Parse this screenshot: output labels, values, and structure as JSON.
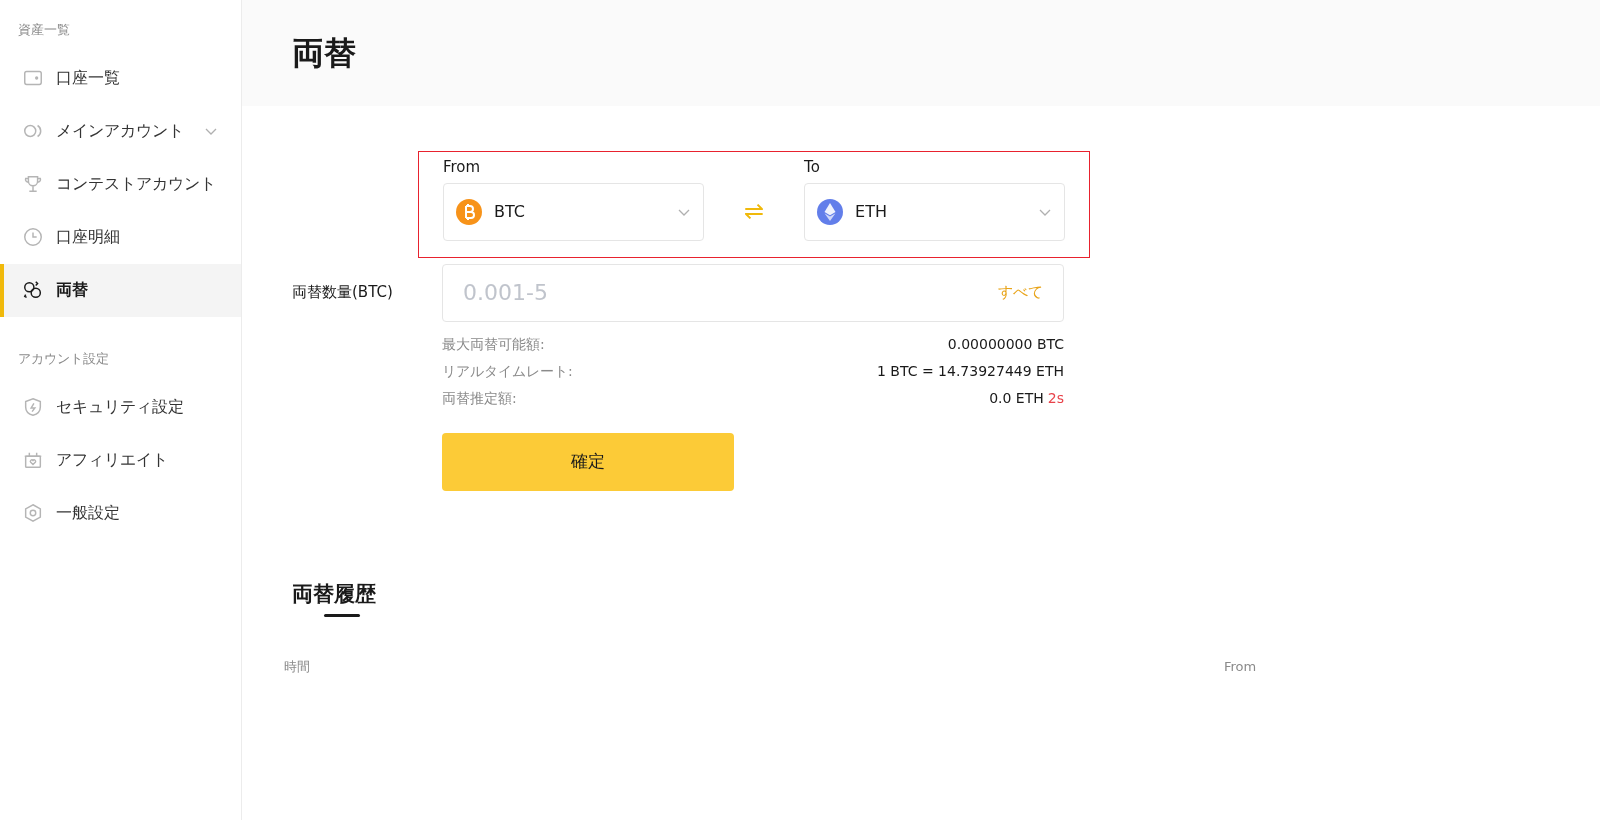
{
  "sidebar": {
    "sections": [
      {
        "heading": "資産一覧",
        "items": [
          {
            "label": "口座一覧",
            "selected": false
          },
          {
            "label": "メインアカウント",
            "selected": false,
            "expanded": false
          },
          {
            "label": "コンテストアカウント",
            "selected": false
          },
          {
            "label": "口座明細",
            "selected": false
          },
          {
            "label": "両替",
            "selected": true
          }
        ]
      },
      {
        "heading": "アカウント設定",
        "items": [
          {
            "label": "セキュリティ設定",
            "selected": false
          },
          {
            "label": "アフィリエイト",
            "selected": false
          },
          {
            "label": "一般設定",
            "selected": false
          }
        ]
      }
    ]
  },
  "page_title": "両替",
  "exchange": {
    "from": {
      "label": "From",
      "currency": "BTC",
      "kind": "btc"
    },
    "swap": "⇌",
    "to": {
      "label": "To",
      "currency": "ETH",
      "kind": "eth"
    },
    "amount": {
      "label": "両替数量(BTC)",
      "placeholder": "0.001-5",
      "all_link": "すべて"
    },
    "info": [
      {
        "label": "最大両替可能額:",
        "value": "0.00000000 BTC"
      },
      {
        "label": "リアルタイムレート:",
        "value": "1 BTC = 14.73927449 ETH"
      },
      {
        "label": "両替推定額:",
        "value": "0.0 ETH",
        "countdown": "2s"
      }
    ],
    "confirm": "確定"
  },
  "history": {
    "title": "両替履歴",
    "columns": [
      "時間",
      "From"
    ]
  }
}
